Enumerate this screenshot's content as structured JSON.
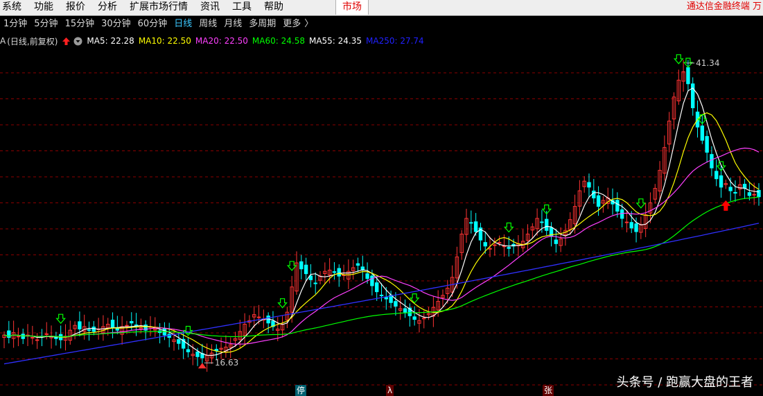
{
  "menubar": {
    "items": [
      "系统",
      "功能",
      "报价",
      "分析",
      "扩展市场行情",
      "资讯",
      "工具",
      "帮助"
    ],
    "market_tab": "市场",
    "brand": "通达信金融终端 万"
  },
  "periods": {
    "items": [
      "1分钟",
      "5分钟",
      "15分钟",
      "30分钟",
      "60分钟",
      "日线",
      "周线",
      "月线",
      "多周期",
      "更多"
    ],
    "active": "日线",
    "more_chevron": "〉"
  },
  "indicator_bar": {
    "prefix": "A",
    "label": "(日线,前复权)",
    "ma": [
      {
        "label": "MA5: 22.28",
        "color": "#ffffff"
      },
      {
        "label": "MA10: 22.50",
        "color": "#ffff00"
      },
      {
        "label": "MA20: 22.50",
        "color": "#ff40ff"
      },
      {
        "label": "MA60: 24.58",
        "color": "#00ff00"
      },
      {
        "label": "MA55: 24.35",
        "color": "#ffffff"
      },
      {
        "label": "MA250: 27.74",
        "color": "#2020ff"
      }
    ]
  },
  "chart_data": {
    "type": "candlestick",
    "annotations": {
      "high_label": "41.34",
      "low_label": "16.63",
      "high_value": 41.34,
      "low_value": 16.63
    },
    "closes": [
      18.6,
      18.4,
      18.8,
      18.5,
      18.3,
      18.6,
      18.4,
      18.2,
      18.5,
      18.7,
      18.5,
      18.3,
      18.2,
      18.5,
      19.0,
      19.4,
      19.1,
      19.3,
      19.0,
      18.9,
      19.1,
      19.3,
      19.5,
      19.2,
      19.0,
      19.3,
      19.4,
      19.6,
      19.4,
      19.2,
      19.0,
      19.3,
      19.1,
      18.8,
      18.6,
      18.4,
      18.2,
      17.9,
      17.5,
      17.2,
      17.0,
      16.8,
      16.7,
      16.9,
      17.1,
      17.3,
      17.5,
      17.6,
      17.8,
      18.3,
      18.9,
      19.5,
      19.8,
      20.3,
      20.1,
      19.9,
      19.6,
      19.3,
      19.1,
      19.5,
      20.5,
      22.6,
      24.6,
      24.1,
      23.7,
      23.2,
      22.9,
      23.5,
      23.9,
      24.0,
      23.8,
      23.5,
      23.6,
      23.9,
      24.2,
      24.4,
      24.0,
      23.3,
      22.7,
      22.2,
      21.9,
      21.6,
      21.3,
      21.0,
      20.8,
      20.5,
      20.2,
      19.9,
      19.8,
      20.0,
      20.4,
      20.9,
      21.4,
      21.9,
      22.5,
      23.4,
      25.1,
      27.0,
      28.3,
      27.9,
      27.2,
      26.5,
      26.0,
      25.8,
      26.1,
      26.3,
      26.0,
      25.8,
      26.0,
      26.2,
      26.4,
      27.0,
      27.6,
      28.3,
      28.0,
      27.3,
      26.8,
      26.2,
      26.6,
      27.3,
      28.2,
      29.3,
      30.6,
      31.4,
      30.9,
      30.0,
      29.3,
      29.8,
      30.0,
      29.5,
      28.9,
      28.3,
      28.0,
      27.5,
      27.2,
      27.8,
      28.6,
      29.6,
      30.8,
      32.3,
      34.2,
      36.4,
      38.4,
      39.8,
      40.5,
      39.5,
      37.5,
      35.9,
      34.8,
      33.8,
      32.5,
      31.6,
      30.9,
      31.2,
      30.6,
      30.4,
      31.1,
      30.8,
      30.2,
      30.3,
      30.1
    ],
    "ma_series": [
      "MA5",
      "MA10",
      "MA20",
      "MA60",
      "MA250"
    ],
    "buy_arrow_indices": [
      12,
      39,
      59,
      61,
      87,
      107,
      115,
      135,
      143,
      145,
      148,
      152
    ],
    "sell_arrow_index": 153
  },
  "colors": {
    "up": "#ff3333",
    "down": "#00ffff",
    "ma5": "#ffffff",
    "ma10": "#ffff00",
    "ma20": "#ff40ff",
    "ma60": "#00ff00",
    "ma250": "#3030ff",
    "grid": "#8b0000",
    "buy_arrow": "#00ff00",
    "sell_arrow": "#ff0000"
  },
  "bottom_tags": [
    {
      "text": "停",
      "bg": "#006070"
    },
    {
      "text": "λ",
      "bg": "#600000"
    },
    {
      "text": "张",
      "bg": "#600000"
    }
  ],
  "watermark": "头条号 / 跑赢大盘的王者"
}
